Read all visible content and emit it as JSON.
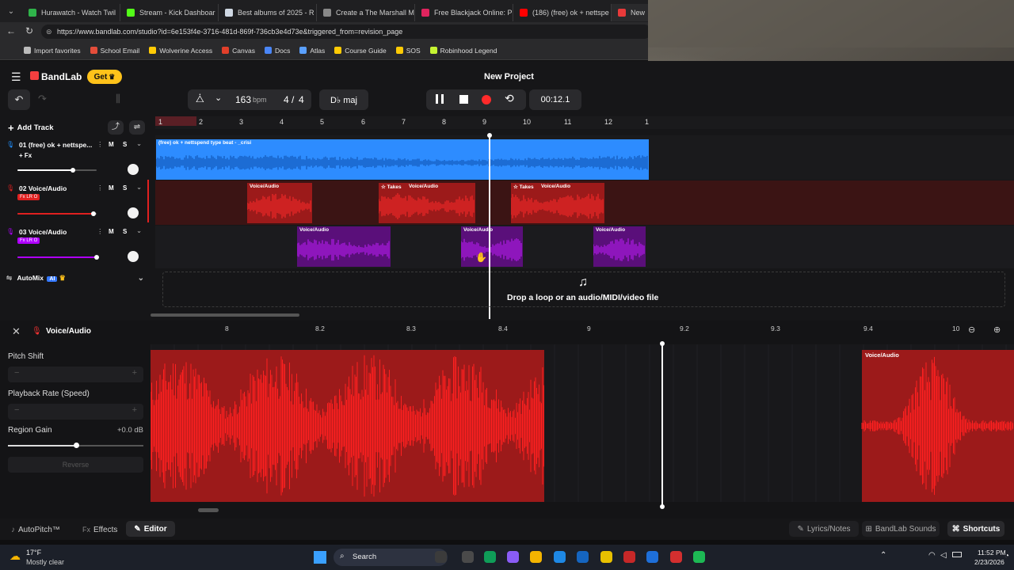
{
  "browser": {
    "tabs": [
      {
        "title": "Hurawatch - Watch Twil",
        "color": "#2fb34a"
      },
      {
        "title": "Stream - Kick Dashboar",
        "color": "#53fc18"
      },
      {
        "title": "Best albums of 2025 - R",
        "color": "#cfd8e3"
      },
      {
        "title": "Create a The Marshall M",
        "color": "#888888"
      },
      {
        "title": "Free Blackjack Online: P",
        "color": "#e0245e"
      },
      {
        "title": "(186) (free) ok + nettspe",
        "color": "#ff0000"
      },
      {
        "title": "New",
        "color": "#e83a3a"
      }
    ],
    "url": "https://www.bandlab.com/studio?id=6e153f4e-3716-481d-869f-736cb3e4d73e&triggered_from=revision_page",
    "bookmarks": [
      {
        "label": "Import favorites",
        "color": "#bbbbbb"
      },
      {
        "label": "School Email",
        "color": "#e44d3a"
      },
      {
        "label": "Wolverine Access",
        "color": "#ffcb05"
      },
      {
        "label": "Canvas",
        "color": "#e13f2a"
      },
      {
        "label": "Docs",
        "color": "#4a86f7"
      },
      {
        "label": "Atlas",
        "color": "#5aa0ff"
      },
      {
        "label": "Course Guide",
        "color": "#ffcb05"
      },
      {
        "label": "SOS",
        "color": "#ffcb05"
      },
      {
        "label": "Robinhood Legend",
        "color": "#c6f432"
      }
    ]
  },
  "app": {
    "brand": "BandLab",
    "get_label": "Get",
    "project_title": "New Project",
    "bpm": "163",
    "bpm_unit": "bpm",
    "time_sig_top": "4",
    "time_sig_sep": "/",
    "time_sig_bottom": "4",
    "key": "D♭ maj",
    "time": "00:12.1",
    "add_track": "Add Track"
  },
  "ruler": [
    "1",
    "2",
    "3",
    "4",
    "5",
    "6",
    "7",
    "8",
    "9",
    "10",
    "11",
    "12",
    "1"
  ],
  "tracks": [
    {
      "name": "01  (free) ok + nettspe...",
      "fx": "+ Fx",
      "color": "#1f8fff",
      "m": "M",
      "s": "S"
    },
    {
      "name": "02  Voice/Audio",
      "fx": "Fx LR O",
      "color": "#e02020",
      "m": "M",
      "s": "S"
    },
    {
      "name": "03  Voice/Audio",
      "fx": "Fx LR O",
      "color": "#b000ff",
      "m": "M",
      "s": "S"
    }
  ],
  "regions": {
    "beat_label": "(free) ok + nettspend type beat - _crisi",
    "voice_label": "Voice/Audio",
    "takes_label": "Takes"
  },
  "automix": {
    "label": "AutoMix",
    "ai": "AI"
  },
  "dropzone": "Drop a loop or an audio/MIDI/video file",
  "editor": {
    "title": "Voice/Audio",
    "pitch_shift": "Pitch Shift",
    "playback_rate": "Playback Rate (Speed)",
    "region_gain": "Region Gain",
    "region_gain_value": "+0.0 dB",
    "reverse": "Reverse",
    "ruler": [
      "8",
      "8.2",
      "8.3",
      "8.4",
      "9",
      "9.2",
      "9.3",
      "9.4",
      "10"
    ],
    "region_label": "Voice/Audio"
  },
  "bottom": {
    "autopitch": "AutoPitch™",
    "effects": "Effects",
    "editor": "Editor",
    "lyrics": "Lyrics/Notes",
    "sounds": "BandLab Sounds",
    "shortcuts": "Shortcuts"
  },
  "taskbar": {
    "temp": "17°F",
    "weather": "Mostly clear",
    "search": "Search",
    "time": "11:52 PM",
    "date": "2/23/2026"
  }
}
